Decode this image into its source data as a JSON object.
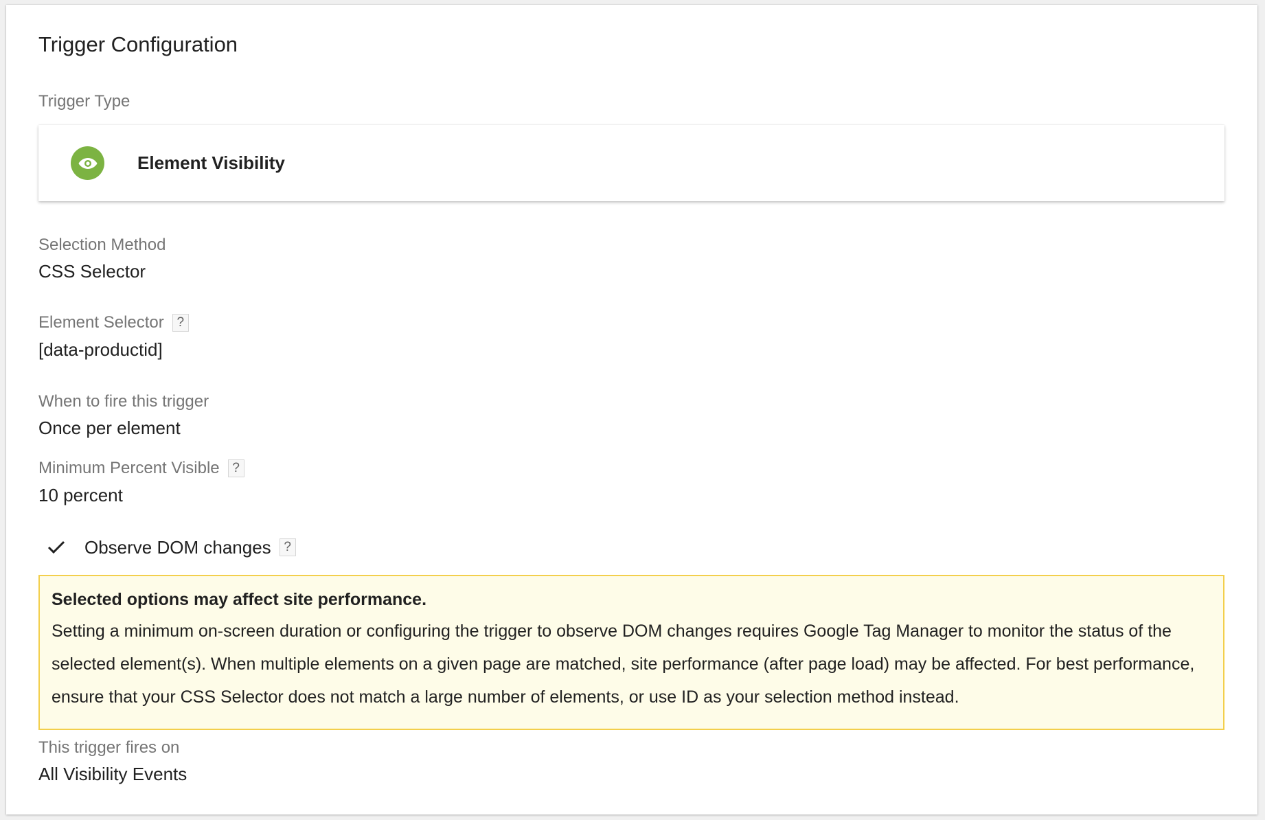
{
  "page": {
    "title": "Trigger Configuration"
  },
  "trigger_type": {
    "label": "Trigger Type",
    "name": "Element Visibility",
    "icon": "eye-icon",
    "icon_color": "#7cb342"
  },
  "selection_method": {
    "label": "Selection Method",
    "value": "CSS Selector"
  },
  "element_selector": {
    "label": "Element Selector",
    "help": "?",
    "value": "[data-productid]"
  },
  "when_to_fire": {
    "label": "When to fire this trigger",
    "value": "Once per element"
  },
  "min_percent_visible": {
    "label": "Minimum Percent Visible",
    "help": "?",
    "value": "10 percent"
  },
  "observe_dom": {
    "label": "Observe DOM changes",
    "checked": true,
    "help": "?"
  },
  "warning": {
    "title": "Selected options may affect site performance.",
    "body": "Setting a minimum on-screen duration or configuring the trigger to observe DOM changes requires Google Tag Manager to monitor the status of the selected element(s). When multiple elements on a given page are matched, site performance (after page load) may be affected. For best performance, ensure that your CSS Selector does not match a large number of elements, or use ID as your selection method instead.",
    "background": "#fefce8",
    "border": "#f3cf4c"
  },
  "fires_on": {
    "label": "This trigger fires on",
    "value": "All Visibility Events"
  }
}
